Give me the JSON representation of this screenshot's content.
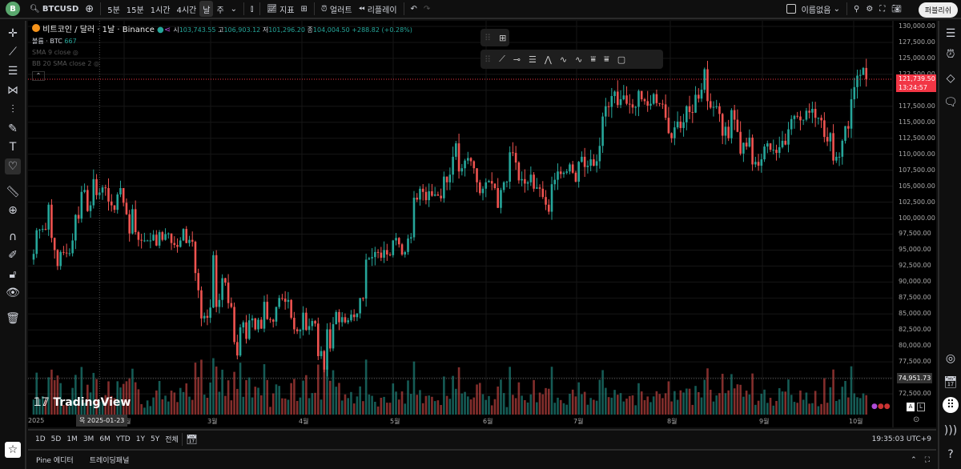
{
  "topbar": {
    "avatar": "B",
    "symbol": "BTCUSD",
    "intervals": [
      "5분",
      "15분",
      "1시간",
      "4시간",
      "날",
      "주"
    ],
    "active_interval": "날",
    "indicators": "지표",
    "alert": "얼러트",
    "replay": "리플레이",
    "layout_name": "이름없음",
    "publish": "퍼블리쉬"
  },
  "legend": {
    "title": "비트코인 / 달러 · 1날 · Binance",
    "o_label": "시",
    "o": "103,743.55",
    "h_label": "고",
    "h": "106,903.12",
    "l_label": "저",
    "l": "101,296.20",
    "c_label": "종",
    "c": "104,004.50",
    "change": "+288.82 (+0.28%)",
    "volume_label": "볼륨 · BTC",
    "volume": "667",
    "sma": "SMA 9 close",
    "bb": "BB 20 SMA close 2"
  },
  "price_axis": {
    "labels": [
      "130,000.00",
      "127,500.00",
      "125,000.00",
      "122,500.00",
      "117,500.00",
      "115,000.00",
      "112,500.00",
      "110,000.00",
      "107,500.00",
      "105,000.00",
      "102,500.00",
      "100,000.00",
      "97,500.00",
      "95,000.00",
      "92,500.00",
      "90,000.00",
      "87,500.00",
      "85,000.00",
      "82,500.00",
      "80,000.00",
      "77,500.00",
      "72,500.00"
    ],
    "last_price": "121,739.50",
    "countdown": "13:24:57",
    "crosshair_price": "74,951.73",
    "scale_a": "A",
    "scale_l": "L"
  },
  "time_axis": {
    "labels": [
      "2025",
      "2월",
      "3월",
      "4월",
      "5월",
      "6월",
      "7월",
      "8월",
      "9월",
      "10월"
    ],
    "crosshair_date": "목 2025-01-23"
  },
  "range_bar": {
    "ranges": [
      "1D",
      "5D",
      "1M",
      "3M",
      "6M",
      "YTD",
      "1Y",
      "5Y",
      "전체"
    ],
    "clock": "19:35:03 UTC+9"
  },
  "bottom_panel": {
    "tabs": [
      "Pine 에디터",
      "트레이딩패널"
    ]
  },
  "brand": "TradingView",
  "colors": {
    "up": "#26a69a",
    "down": "#ef5350",
    "background": "#000000",
    "last_price": "#f23645"
  },
  "chart_data": {
    "type": "candlestick",
    "title": "비트코인 / 달러 · 1날 · Binance",
    "start_date": "2025-01-01",
    "interval": "1D",
    "ylim": [
      72500,
      130000
    ],
    "unit": "USD (thousands in closes)",
    "last": 121739.5,
    "closes": [
      94.4,
      98.1,
      98.2,
      98.3,
      98.2,
      102.1,
      96.9,
      95.0,
      92.5,
      94.7,
      94.6,
      94.5,
      94.5,
      96.5,
      100.5,
      99.9,
      104.1,
      104.4,
      101.1,
      102.0,
      106.1,
      103.6,
      104.0,
      104.8,
      104.7,
      102.6,
      102.0,
      101.3,
      103.7,
      104.7,
      102.4,
      100.6,
      97.6,
      101.4,
      97.8,
      96.6,
      96.5,
      96.5,
      96.5,
      96.5,
      97.4,
      95.7,
      97.8,
      96.6,
      97.5,
      97.6,
      96.1,
      95.8,
      95.5,
      96.5,
      98.3,
      96.1,
      96.6,
      96.3,
      91.4,
      88.7,
      84.3,
      84.7,
      84.4,
      86.0,
      94.2,
      86.1,
      87.2,
      90.6,
      89.9,
      86.7,
      86.1,
      80.6,
      78.5,
      82.9,
      83.7,
      81.1,
      84.0,
      84.3,
      82.6,
      84.1,
      82.7,
      86.9,
      84.2,
      84.1,
      83.8,
      86.1,
      87.5,
      87.4,
      86.9,
      87.2,
      84.4,
      82.6,
      82.3,
      82.5,
      85.2,
      82.5,
      83.1,
      83.9,
      83.5,
      78.4,
      79.2,
      76.3,
      82.6,
      79.6,
      83.4,
      85.3,
      83.7,
      84.5,
      83.7,
      84.0,
      84.9,
      84.5,
      85.1,
      87.5,
      87.4,
      93.5,
      93.7,
      93.9,
      94.7,
      94.6,
      93.8,
      95.0,
      94.3,
      94.2,
      96.5,
      96.9,
      95.9,
      94.3,
      94.7,
      96.8,
      97.0,
      103.2,
      102.9,
      104.6,
      104.1,
      102.8,
      104.2,
      103.5,
      103.7,
      103.5,
      103.1,
      106.5,
      105.6,
      106.8,
      109.6,
      111.7,
      107.3,
      107.8,
      109.0,
      109.4,
      108.9,
      107.8,
      105.6,
      103.9,
      104.6,
      105.6,
      105.8,
      105.4,
      104.7,
      101.6,
      104.4,
      105.6,
      105.7,
      110.3,
      110.2,
      108.7,
      105.9,
      106.1,
      105.4,
      105.6,
      106.8,
      104.6,
      104.8,
      104.6,
      103.3,
      102.1,
      101.0,
      105.3,
      106.0,
      107.3,
      106.9,
      107.1,
      107.3,
      108.4,
      107.1,
      105.7,
      108.8,
      109.6,
      108.0,
      108.2,
      109.2,
      108.2,
      108.9,
      111.3,
      115.9,
      117.5,
      117.4,
      119.1,
      119.8,
      117.7,
      118.6,
      119.2,
      117.9,
      117.8,
      117.3,
      117.4,
      119.9,
      118.6,
      118.3,
      117.6,
      117.9,
      119.4,
      118.0,
      117.9,
      117.8,
      115.7,
      113.3,
      112.5,
      114.2,
      115.1,
      114.1,
      115.0,
      117.5,
      116.6,
      116.5,
      119.3,
      118.7,
      120.1,
      123.3,
      118.3,
      117.3,
      117.4,
      117.5,
      116.3,
      112.9,
      114.3,
      112.5,
      116.9,
      115.4,
      113.5,
      110.1,
      111.8,
      111.2,
      112.6,
      108.4,
      108.8,
      108.2,
      109.2,
      111.2,
      111.7,
      110.7,
      110.7,
      110.2,
      111.1,
      112.1,
      111.5,
      113.9,
      115.5,
      116.0,
      115.9,
      115.3,
      115.4,
      116.8,
      116.5,
      117.1,
      115.7,
      115.7,
      115.3,
      112.7,
      112.0,
      113.3,
      109.0,
      109.6,
      109.6,
      112.1,
      114.4,
      114.0,
      118.6,
      120.5,
      122.3,
      122.4,
      123.5,
      121.7
    ]
  }
}
